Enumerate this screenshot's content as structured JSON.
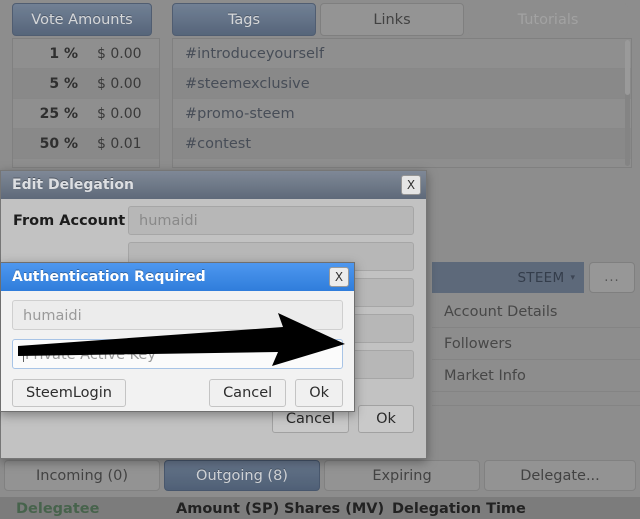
{
  "app": {
    "top_tabs_left": [
      {
        "label": "Vote Amounts",
        "state": "active"
      }
    ],
    "top_tabs_right": [
      {
        "label": "Tags",
        "state": "active"
      },
      {
        "label": "Links",
        "state": "normal"
      },
      {
        "label": "Tutorials",
        "state": "disabled"
      }
    ],
    "vote_amounts": [
      {
        "percent": "1 %",
        "value": "$ 0.00"
      },
      {
        "percent": "5 %",
        "value": "$ 0.00"
      },
      {
        "percent": "25 %",
        "value": "$ 0.00"
      },
      {
        "percent": "50 %",
        "value": "$ 0.01"
      }
    ],
    "tags": [
      "#introduceyourself",
      "#steemexclusive",
      "#promo-steem",
      "#contest"
    ],
    "side_menu": [
      "Account Details",
      "Followers",
      "Market Info"
    ],
    "currency_selector": {
      "value": "STEEM",
      "caret": "▾",
      "more_button": "..."
    },
    "bottom_tabs": [
      {
        "label": "Incoming (0)",
        "state": "normal"
      },
      {
        "label": "Outgoing (8)",
        "state": "active"
      },
      {
        "label": "Expiring",
        "state": "normal"
      },
      {
        "label": "Delegate...",
        "state": "normal"
      }
    ],
    "table_headers": [
      {
        "label": "Delegatee",
        "sorted": true
      },
      {
        "label": "Amount (SP)",
        "sorted": false
      },
      {
        "label": "Shares (MV)",
        "sorted": false
      },
      {
        "label": "Delegation Time",
        "sorted": false
      }
    ]
  },
  "edit_delegation_dialog": {
    "title": "Edit Delegation",
    "close_label": "X",
    "fields": [
      {
        "label": "From Account",
        "value": "humaidi"
      }
    ],
    "buttons": {
      "cancel": "Cancel",
      "ok": "Ok"
    }
  },
  "auth_dialog": {
    "title": "Authentication Required",
    "close_label": "X",
    "account_value": "humaidi",
    "key_placeholder": "Private Active Key",
    "buttons": {
      "steemlogin": "SteemLogin",
      "cancel": "Cancel",
      "ok": "Ok"
    }
  },
  "colors": {
    "accent_blue": "#3f6fb5",
    "active_title_blue": "#2f7ddb",
    "tag_link": "#3e5273",
    "sorted_header_green": "#1f7a2e",
    "background_gray": "#8d8d8d"
  }
}
